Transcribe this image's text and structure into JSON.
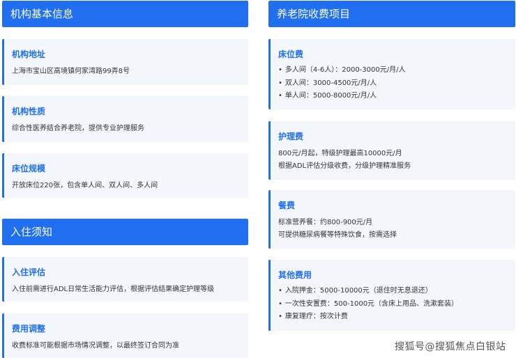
{
  "left": {
    "section1": {
      "title": "机构基本信息",
      "cards": [
        {
          "title": "机构地址",
          "text": "上海市宝山区高境镇何家湾路99弄8号"
        },
        {
          "title": "机构性质",
          "text": "综合性医养结合养老院，提供专业护理服务"
        },
        {
          "title": "床位规模",
          "text": "开放床位220张，包含单人间、双人间、多人间"
        }
      ]
    },
    "section2": {
      "title": "入住须知",
      "cards": [
        {
          "title": "入住评估",
          "text": "入住前需进行ADL日常生活能力评估，根据评估结果确定护理等级"
        },
        {
          "title": "费用调整",
          "text": "收费标准可能根据市场情况调整，以最终签订合同为准"
        }
      ]
    }
  },
  "right": {
    "title": "养老院收费项目",
    "bed": {
      "title": "床位费",
      "items": [
        "多人间（4-6人）：2000-3000元/月/人",
        "双人间：3000-4500元/月/人",
        "单人间：5000-8000元/月/人"
      ]
    },
    "care": {
      "title": "护理费",
      "lines": [
        "800元/月起，特级护理最高10000元/月",
        "根据ADL评估分级收费，分级护理精准服务"
      ]
    },
    "meal": {
      "title": "餐费",
      "lines": [
        "标准营养餐：约800-900元/月",
        "可提供糖尿病餐等特殊饮食，按需选择"
      ]
    },
    "other": {
      "title": "其他费用",
      "items": [
        "入院押金：5000-10000元（退住时无息退还）",
        "一次性安置费：500-1000元（含床上用品、洗漱套装）",
        "康复理疗：按次计费"
      ]
    }
  },
  "watermark": "搜狐号@搜狐焦点白银站"
}
